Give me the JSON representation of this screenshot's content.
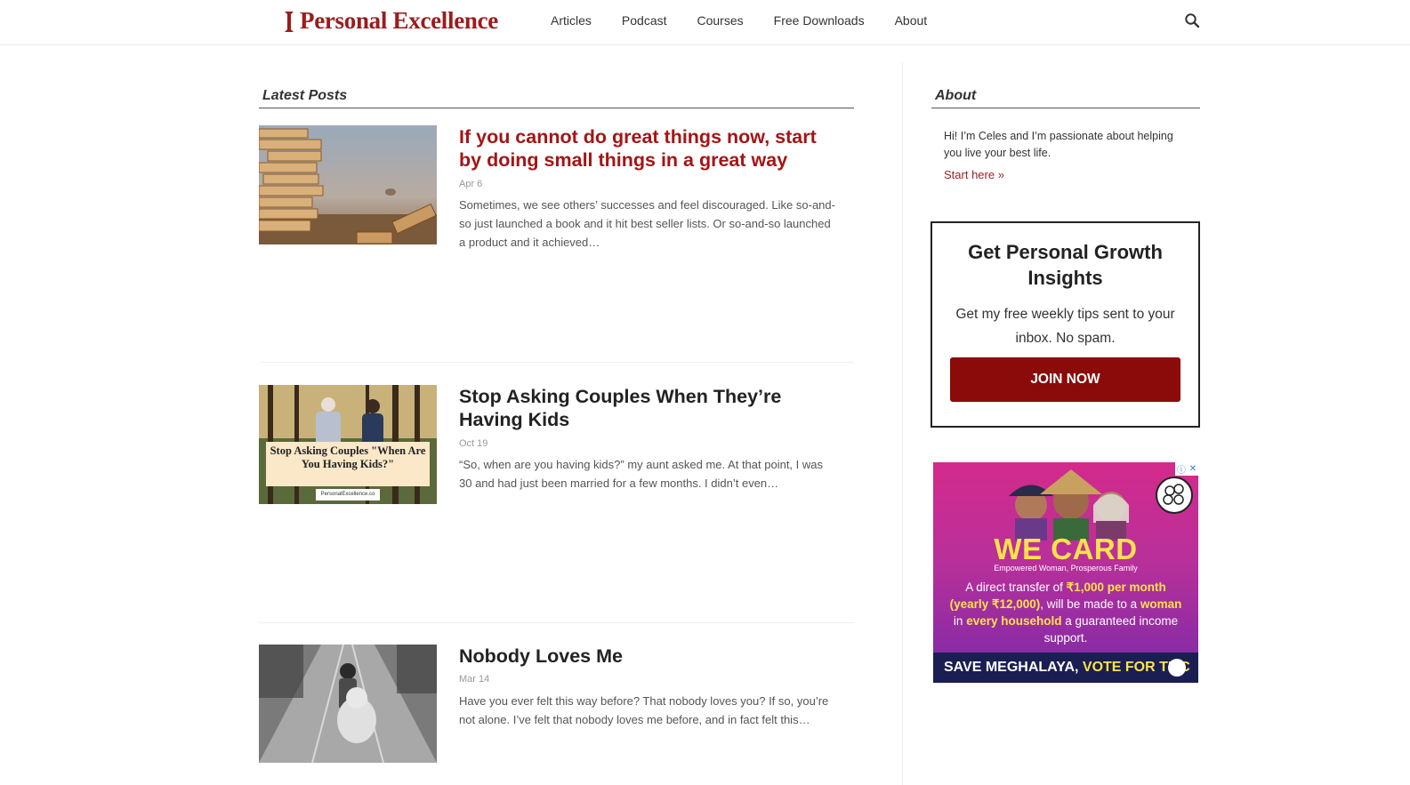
{
  "header": {
    "logo_text": "Personal Excellence",
    "nav": [
      "Articles",
      "Podcast",
      "Courses",
      "Free Downloads",
      "About"
    ],
    "search_icon": "search-icon"
  },
  "main": {
    "section_title": "Latest Posts",
    "posts": [
      {
        "title": "If you cannot do great things now, start by doing small things in a great way",
        "date": "Apr 6",
        "excerpt": "Sometimes, we see others’ successes and feel discouraged. Like so-and-so just launched a book and it hit best seller lists. Or so-and-so launched a product and it achieved…",
        "thumb": "jenga-blocks-photo"
      },
      {
        "title": "Stop Asking Couples When They’re Having Kids",
        "date": "Oct 19",
        "excerpt": "“So, when are you having kids?” my aunt asked me. At that point, I was 30 and had just been married for a few months. I didn’t even…",
        "thumb": "couple-walking-photo",
        "thumb_caption": "Stop Asking Couples \"When Are You Having Kids?\"",
        "thumb_site": "PersonalExcellence.co"
      },
      {
        "title": "Nobody Loves Me",
        "date": "Mar 14",
        "excerpt": "Have you ever felt this way before? That nobody loves you? If so, you’re not alone. I’ve felt that nobody loves me before, and in fact felt this…",
        "thumb": "child-with-teddy-bear-photo"
      }
    ]
  },
  "sidebar": {
    "about_title": "About",
    "about_text": "Hi! I’m Celes and I’m passionate about helping you live your best life.",
    "about_link": "Start here »",
    "signup": {
      "title": "Get Personal Growth Insights",
      "text": "Get my free weekly tips sent to your inbox. No spam.",
      "button": "JOIN NOW"
    },
    "ad": {
      "headline": "WE CARD",
      "tagline": "Empowered Woman, Prosperous Family",
      "body_1": "A direct transfer of ",
      "body_hl_1": "₹1,000 per month (yearly ₹12,000)",
      "body_2": ", will be made to a ",
      "body_hl_2": "woman",
      "body_3": " in ",
      "body_hl_3": "every household",
      "body_4": " a guaranteed income support.",
      "footer_1": "SAVE MEGHALAYA, ",
      "footer_2": "VOTE FOR TMC"
    }
  },
  "colors": {
    "brand_red": "#9b1c1c",
    "button_red": "#8b0a0a",
    "ad_pink": "#d42a8c",
    "ad_yellow": "#ffe24a"
  }
}
